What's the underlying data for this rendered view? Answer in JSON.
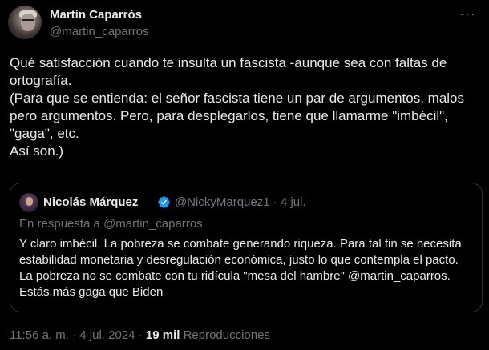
{
  "author": {
    "name": "Martín Caparrós",
    "handle": "@martin_caparros"
  },
  "more_icon": "more-horizontal-icon",
  "tweet_lines": [
    "Qué satisfacción cuando te insulta un fascista -aunque sea con faltas de ortografía.",
    "(Para que se entienda: el señor fascista tiene un par de argumentos, malos pero argumentos. Pero, para desplegarlos, tiene que llamarme \"imbécil\", \"gaga\", etc.",
    "Así son.)"
  ],
  "quoted": {
    "name": "Nicolás Márquez",
    "verified_icon": "verified-badge-icon",
    "handle": "@NickyMarquez1",
    "separator": "·",
    "date": "4 jul.",
    "reply_to": "En respuesta a @martin_caparros",
    "text": "Y claro imbécil. La pobreza se combate generando riqueza. Para tal fin se necesita estabilidad monetaria y desregulación económica, justo lo que contempla el pacto. La pobreza no se combate con tu ridícula \"mesa del hambre\" @martin_caparros. Estás más gaga que Biden"
  },
  "footer": {
    "time": "11:56 a. m.",
    "separator": "·",
    "date": "4 jul. 2024",
    "views_count": "19 mil",
    "views_label": "Reproducciones"
  },
  "colors": {
    "background": "#000000",
    "text": "#e7e9ea",
    "secondary": "#71767b",
    "border": "#2f3336",
    "verified": "#1d9bf0"
  }
}
